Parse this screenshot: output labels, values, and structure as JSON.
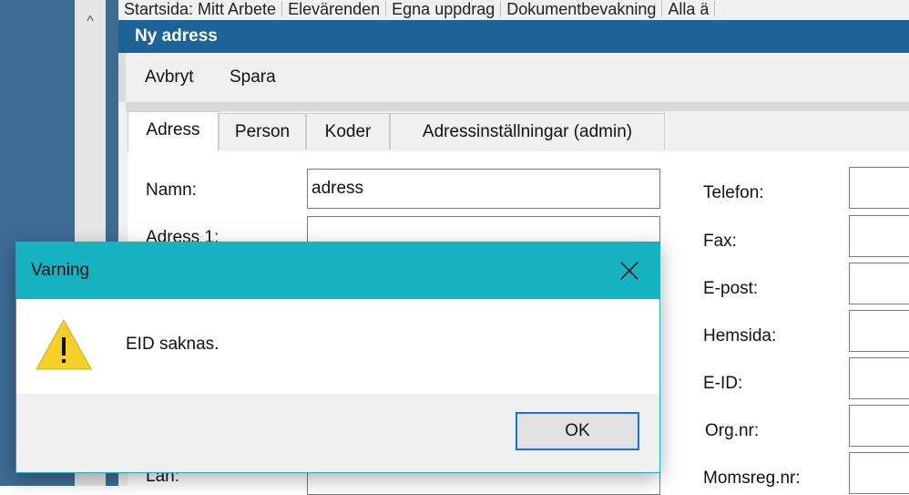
{
  "background_tabs": [
    "Startsida: Mitt Arbete",
    "Elevärenden",
    "Egna uppdrag",
    "Dokumentbevakning",
    "Alla ä"
  ],
  "window": {
    "title": "Ny adress"
  },
  "toolbar": {
    "cancel_label": "Avbryt",
    "save_label": "Spara"
  },
  "tabs": [
    "Adress",
    "Person",
    "Koder",
    "Adressinställningar (admin)"
  ],
  "form": {
    "left": [
      {
        "label": "Namn:",
        "value": "adress"
      },
      {
        "label": "Adress 1:",
        "value": ""
      },
      {
        "label": "Län:",
        "value": ""
      }
    ],
    "right": [
      {
        "label": "Telefon:"
      },
      {
        "label": "Fax:"
      },
      {
        "label": "E-post:"
      },
      {
        "label": "Hemsida:"
      },
      {
        "label": "E-ID:"
      },
      {
        "label": "Org.nr:"
      },
      {
        "label": "Momsreg.nr:"
      }
    ]
  },
  "dialog": {
    "title": "Varning",
    "message": "EID saknas.",
    "ok_label": "OK",
    "icon": "warning-icon",
    "close_icon": "close-icon"
  },
  "colors": {
    "window_title_bg": "#1e6398",
    "dialog_title_bg": "#16b2c2",
    "ok_border": "#1474d4",
    "warning_yellow": "#f7cf2a"
  }
}
